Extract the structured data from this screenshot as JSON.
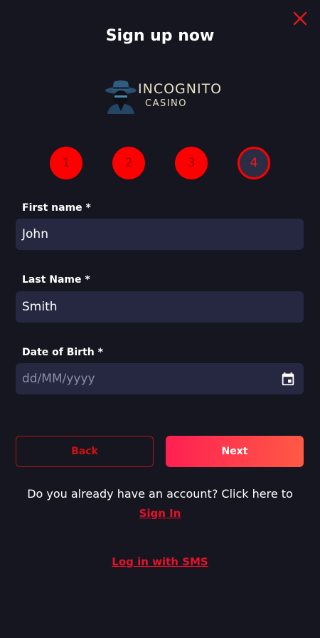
{
  "header": {
    "title": "Sign up now"
  },
  "logo": {
    "line1": "INCOGNITO",
    "line2": "CASINO"
  },
  "steps": [
    {
      "label": "1",
      "active": false
    },
    {
      "label": "2",
      "active": false
    },
    {
      "label": "3",
      "active": false
    },
    {
      "label": "4",
      "active": true
    }
  ],
  "form": {
    "first_name": {
      "label": "First name *",
      "value": "John"
    },
    "last_name": {
      "label": "Last Name *",
      "value": "Smith"
    },
    "dob": {
      "label": "Date of Birth *",
      "placeholder": "dd/MM/yyyy"
    }
  },
  "buttons": {
    "back": "Back",
    "next": "Next"
  },
  "footer": {
    "signin_prompt": "Do you already have an account? Click here to",
    "signin_link": "Sign In",
    "sms_link": "Log in with SMS"
  },
  "colors": {
    "background": "#15161f",
    "accent": "#ff0000",
    "field_bg": "#252840"
  }
}
